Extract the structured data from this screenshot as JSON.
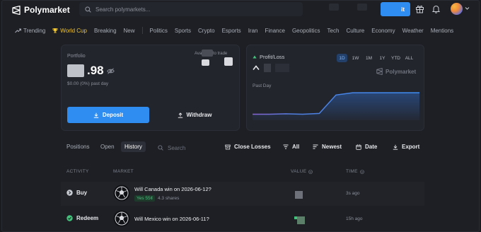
{
  "app": {
    "name": "Polymarket"
  },
  "header": {
    "search_placeholder": "Search polymarkets...",
    "login_label": "it"
  },
  "nav": [
    {
      "label": "Trending",
      "icon": "trending-icon"
    },
    {
      "label": "World Cup",
      "icon": "trophy-icon",
      "active": true
    },
    {
      "label": "Breaking"
    },
    {
      "label": "New"
    },
    {
      "label": "Politics"
    },
    {
      "label": "Sports"
    },
    {
      "label": "Crypto"
    },
    {
      "label": "Esports"
    },
    {
      "label": "Iran"
    },
    {
      "label": "Finance"
    },
    {
      "label": "Geopolitics"
    },
    {
      "label": "Tech"
    },
    {
      "label": "Culture"
    },
    {
      "label": "Economy"
    },
    {
      "label": "Weather"
    },
    {
      "label": "Mentions"
    }
  ],
  "portfolio": {
    "title": "Portfolio",
    "available_label": "Available to trade",
    "value_suffix": ".98",
    "change_text": "$0.00 (0%) past day",
    "deposit_label": "Deposit",
    "withdraw_label": "Withdraw"
  },
  "pnl": {
    "title": "Profit/Loss",
    "period_label": "Past Day",
    "watermark": "Polymarket",
    "ranges": [
      "1D",
      "1W",
      "1M",
      "1Y",
      "YTD",
      "ALL"
    ],
    "active_range": "1D",
    "series": [
      0.12,
      0.12,
      0.13,
      0.12,
      0.14,
      0.62,
      0.68,
      0.68,
      0.68,
      0.68,
      0.68
    ]
  },
  "history": {
    "tabs": [
      "Positions",
      "Open",
      "History"
    ],
    "active_tab": "History",
    "search_placeholder": "Search",
    "close_losses_label": "Close Losses",
    "filter_all_label": "All",
    "sort_label": "Newest",
    "date_label": "Date",
    "export_label": "Export",
    "columns": {
      "activity": "ACTIVITY",
      "market": "MARKET",
      "value": "VALUE",
      "time": "TIME"
    },
    "rows": [
      {
        "type": "Buy",
        "market": "Will Canada win on 2026-06-12?",
        "outcome": "Yes 55¢",
        "shares": "4.3 shares",
        "time": "3s ago"
      },
      {
        "type": "Redeem",
        "market": "Will Mexico win on 2026-06-11?",
        "time": "15h ago"
      }
    ]
  },
  "colors": {
    "accent": "#2f8cf0",
    "active_category": "#f1c531",
    "positive": "#43c27c"
  }
}
